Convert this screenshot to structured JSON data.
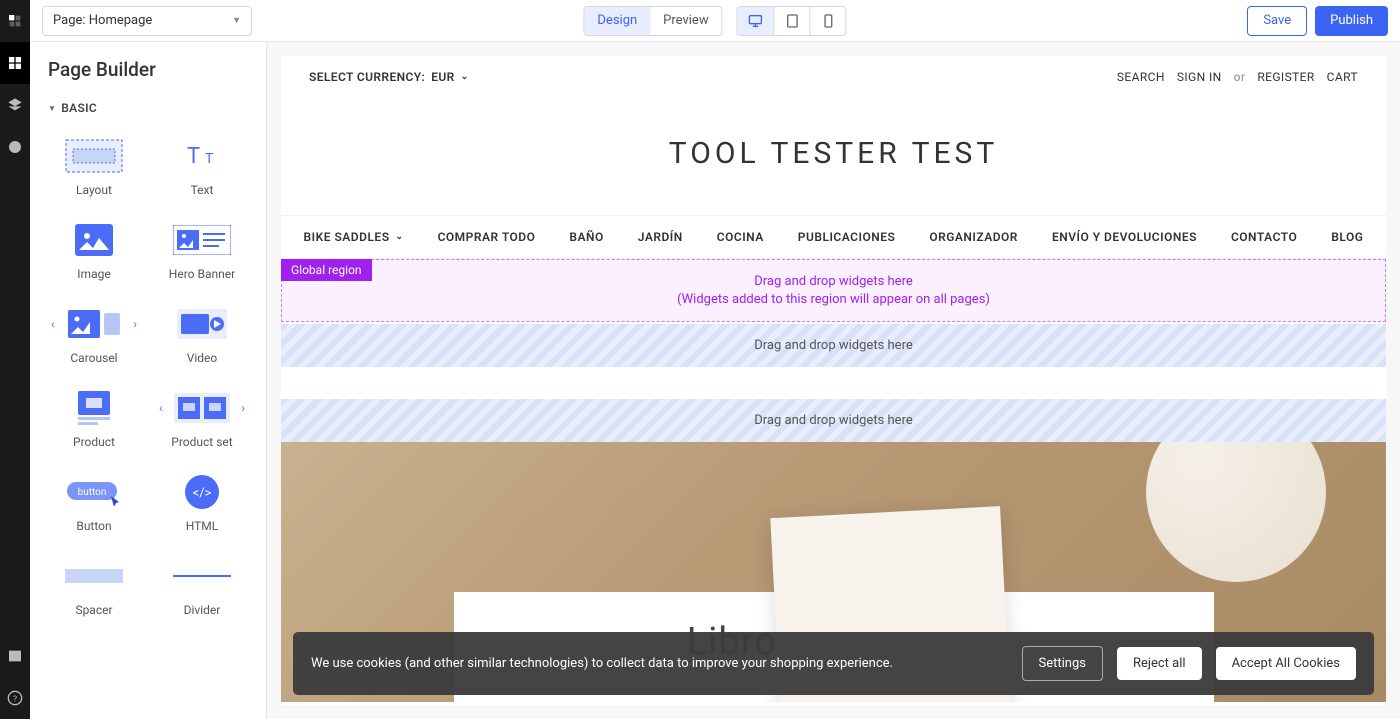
{
  "topbar": {
    "page_select": "Page: Homepage",
    "design": "Design",
    "preview": "Preview",
    "save": "Save",
    "publish": "Publish"
  },
  "panel": {
    "title": "Page Builder",
    "section_basic": "BASIC",
    "widgets": {
      "layout": "Layout",
      "text": "Text",
      "image": "Image",
      "hero": "Hero Banner",
      "carousel": "Carousel",
      "video": "Video",
      "product": "Product",
      "product_set": "Product set",
      "button": "Button",
      "html": "HTML",
      "spacer": "Spacer",
      "divider": "Divider"
    }
  },
  "store": {
    "currency_label": "SELECT CURRENCY:",
    "currency_value": "EUR",
    "search": "SEARCH",
    "signin": "SIGN IN",
    "or": "or",
    "register": "REGISTER",
    "cart": "CART",
    "title": "TOOL TESTER TEST",
    "nav": [
      "BIKE SADDLES",
      "COMPRAR TODO",
      "BAÑO",
      "JARDÍN",
      "COCINA",
      "PUBLICACIONES",
      "ORGANIZADOR",
      "ENVÍO Y DEVOLUCIONES",
      "CONTACTO",
      "BLOG"
    ],
    "global_tag": "Global region",
    "global_line1": "Drag and drop widgets here",
    "global_line2": "(Widgets added to this region will appear on all pages)",
    "drop_text": "Drag and drop widgets here",
    "hero_title": "Libros de cocina"
  },
  "cookies": {
    "msg": "We use cookies (and other similar technologies) to collect data to improve your shopping experience.",
    "settings": "Settings",
    "reject": "Reject all",
    "accept": "Accept All Cookies"
  }
}
